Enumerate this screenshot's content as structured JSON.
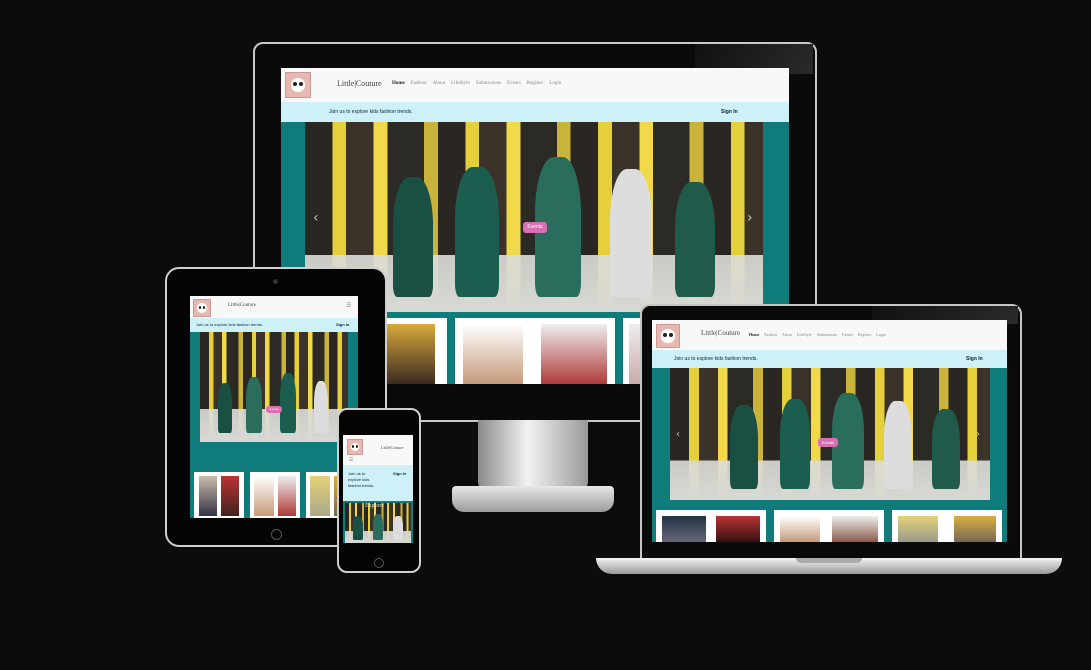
{
  "site": {
    "brand": "Little|Couture",
    "menu": [
      "Home",
      "Fashion",
      "About",
      "LifeStyle",
      "Submissions",
      "Events",
      "Register",
      "Login"
    ],
    "join_text": "Join us to explore kids fashion trends.",
    "join_text_short": "Join us to explore kids fashion trends.",
    "sign_in": "Sign In",
    "events_button": "Events",
    "hero_caption": "Explore"
  },
  "icons": {
    "logo": "panda-logo-icon",
    "hamburger": "hamburger-menu-icon",
    "prev": "chevron-left-icon",
    "next": "chevron-right-icon"
  },
  "glyphs": {
    "prev": "‹",
    "next": "›",
    "hamburger": "☰"
  },
  "colors": {
    "background": "#0c0c0c",
    "accent_teal": "#0f7b7b",
    "join_bar": "#cdf1f6",
    "events_pink": "#d86fb3",
    "logo_bg": "#e6b8b0"
  }
}
